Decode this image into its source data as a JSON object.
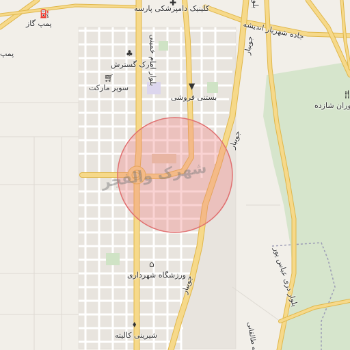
{
  "map": {
    "highlight_color": "#f08080",
    "road_color": "#f6d98a",
    "road_border": "#e0b74a",
    "park_color": "#cfe3c5",
    "district_name": "شهرک والفجر",
    "labels": {
      "pump": "پمپ گاز",
      "pump_partial": "پمپ",
      "clinic": "کلینیک دامپزشکی پارسه",
      "andisheh": "جاده شهریار اندیشه",
      "park": "پارک گسترش",
      "market": "سوپر مارکت",
      "ice": "بستنی فروشی",
      "restaurant": "وران شازده",
      "imam": "بلوار امام خمینی",
      "javid1": "جویبار",
      "javid2": "جویبار",
      "javid3": "جویبار",
      "gym": "ورزشگاه شهرداری",
      "sweets": "شیرینی کالیته",
      "abbaspour": "بلوار دری عباس پور",
      "ayatollah_partial": "آیت‌اله طالقانی",
      "top_edge": "بلو"
    },
    "icons": {
      "pump": "fuel-icon",
      "clinic": "veterinary-icon",
      "park": "tree-icon",
      "market": "cart-icon",
      "ice": "icecream-icon",
      "restaurant": "fork-knife-icon",
      "gym": "stadium-icon",
      "sweets": "bakery-icon"
    }
  }
}
